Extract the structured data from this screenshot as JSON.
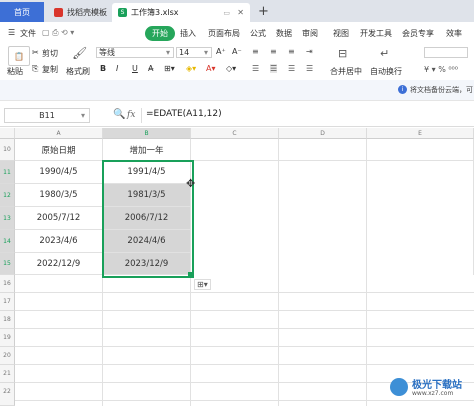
{
  "tabs": {
    "home": "首页",
    "template": "找稻壳模板",
    "workbook": "工作簿3.xlsx",
    "new_tab": "+"
  },
  "menu": {
    "file": "文件",
    "start": "开始",
    "insert": "插入",
    "page_layout": "页面布局",
    "formula": "公式",
    "data": "数据",
    "review": "审阅",
    "view": "视图",
    "dev_tools": "开发工具",
    "member": "会员专享",
    "effect": "效率"
  },
  "toolbar": {
    "cut": "剪切",
    "copy": "复制",
    "paste": "粘贴",
    "format_painter": "格式刷",
    "font_name": "等线",
    "font_size": "14",
    "bold": "B",
    "italic": "I",
    "underline": "U",
    "merge_center": "合并居中",
    "wrap_text": "自动换行"
  },
  "infobar": {
    "text": "将文档备份云端，可"
  },
  "formula_bar": {
    "name_box": "B11",
    "zoom_icon_label": "Q",
    "fx": "fx",
    "formula": "=EDATE(A11,12)"
  },
  "grid": {
    "columns": [
      "A",
      "B",
      "C",
      "D",
      "E"
    ],
    "rows": [
      "10",
      "11",
      "12",
      "13",
      "14",
      "15",
      "16",
      "17",
      "18",
      "19",
      "20",
      "21",
      "22"
    ],
    "header_a": "原始日期",
    "header_b": "增加一年",
    "col_a": [
      "1990/4/5",
      "1980/3/5",
      "2005/7/12",
      "2023/4/6",
      "2022/12/9"
    ],
    "col_b": [
      "1991/4/5",
      "1981/3/5",
      "2006/7/12",
      "2024/4/6",
      "2023/12/9"
    ],
    "selected_column": "B",
    "selected_rows": [
      "11",
      "12",
      "13",
      "14",
      "15"
    ]
  },
  "watermark": {
    "text": "极光下载站",
    "url": "www.xz7.com"
  },
  "colors": {
    "accent_green": "#19a05a",
    "home_tab": "#3d6fd6",
    "selection_fill": "#d6d6d6"
  }
}
